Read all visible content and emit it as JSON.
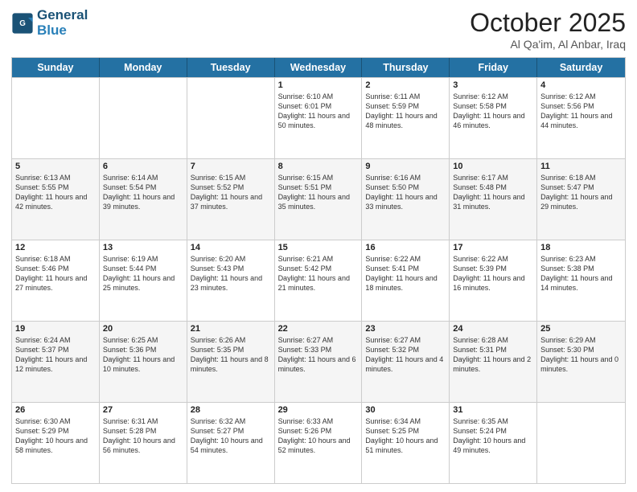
{
  "header": {
    "logo_line1": "General",
    "logo_line2": "Blue",
    "month": "October 2025",
    "location": "Al Qa'im, Al Anbar, Iraq"
  },
  "days_of_week": [
    "Sunday",
    "Monday",
    "Tuesday",
    "Wednesday",
    "Thursday",
    "Friday",
    "Saturday"
  ],
  "weeks": [
    [
      {
        "day": "",
        "sunrise": "",
        "sunset": "",
        "daylight": ""
      },
      {
        "day": "",
        "sunrise": "",
        "sunset": "",
        "daylight": ""
      },
      {
        "day": "",
        "sunrise": "",
        "sunset": "",
        "daylight": ""
      },
      {
        "day": "1",
        "sunrise": "Sunrise: 6:10 AM",
        "sunset": "Sunset: 6:01 PM",
        "daylight": "Daylight: 11 hours and 50 minutes."
      },
      {
        "day": "2",
        "sunrise": "Sunrise: 6:11 AM",
        "sunset": "Sunset: 5:59 PM",
        "daylight": "Daylight: 11 hours and 48 minutes."
      },
      {
        "day": "3",
        "sunrise": "Sunrise: 6:12 AM",
        "sunset": "Sunset: 5:58 PM",
        "daylight": "Daylight: 11 hours and 46 minutes."
      },
      {
        "day": "4",
        "sunrise": "Sunrise: 6:12 AM",
        "sunset": "Sunset: 5:56 PM",
        "daylight": "Daylight: 11 hours and 44 minutes."
      }
    ],
    [
      {
        "day": "5",
        "sunrise": "Sunrise: 6:13 AM",
        "sunset": "Sunset: 5:55 PM",
        "daylight": "Daylight: 11 hours and 42 minutes."
      },
      {
        "day": "6",
        "sunrise": "Sunrise: 6:14 AM",
        "sunset": "Sunset: 5:54 PM",
        "daylight": "Daylight: 11 hours and 39 minutes."
      },
      {
        "day": "7",
        "sunrise": "Sunrise: 6:15 AM",
        "sunset": "Sunset: 5:52 PM",
        "daylight": "Daylight: 11 hours and 37 minutes."
      },
      {
        "day": "8",
        "sunrise": "Sunrise: 6:15 AM",
        "sunset": "Sunset: 5:51 PM",
        "daylight": "Daylight: 11 hours and 35 minutes."
      },
      {
        "day": "9",
        "sunrise": "Sunrise: 6:16 AM",
        "sunset": "Sunset: 5:50 PM",
        "daylight": "Daylight: 11 hours and 33 minutes."
      },
      {
        "day": "10",
        "sunrise": "Sunrise: 6:17 AM",
        "sunset": "Sunset: 5:48 PM",
        "daylight": "Daylight: 11 hours and 31 minutes."
      },
      {
        "day": "11",
        "sunrise": "Sunrise: 6:18 AM",
        "sunset": "Sunset: 5:47 PM",
        "daylight": "Daylight: 11 hours and 29 minutes."
      }
    ],
    [
      {
        "day": "12",
        "sunrise": "Sunrise: 6:18 AM",
        "sunset": "Sunset: 5:46 PM",
        "daylight": "Daylight: 11 hours and 27 minutes."
      },
      {
        "day": "13",
        "sunrise": "Sunrise: 6:19 AM",
        "sunset": "Sunset: 5:44 PM",
        "daylight": "Daylight: 11 hours and 25 minutes."
      },
      {
        "day": "14",
        "sunrise": "Sunrise: 6:20 AM",
        "sunset": "Sunset: 5:43 PM",
        "daylight": "Daylight: 11 hours and 23 minutes."
      },
      {
        "day": "15",
        "sunrise": "Sunrise: 6:21 AM",
        "sunset": "Sunset: 5:42 PM",
        "daylight": "Daylight: 11 hours and 21 minutes."
      },
      {
        "day": "16",
        "sunrise": "Sunrise: 6:22 AM",
        "sunset": "Sunset: 5:41 PM",
        "daylight": "Daylight: 11 hours and 18 minutes."
      },
      {
        "day": "17",
        "sunrise": "Sunrise: 6:22 AM",
        "sunset": "Sunset: 5:39 PM",
        "daylight": "Daylight: 11 hours and 16 minutes."
      },
      {
        "day": "18",
        "sunrise": "Sunrise: 6:23 AM",
        "sunset": "Sunset: 5:38 PM",
        "daylight": "Daylight: 11 hours and 14 minutes."
      }
    ],
    [
      {
        "day": "19",
        "sunrise": "Sunrise: 6:24 AM",
        "sunset": "Sunset: 5:37 PM",
        "daylight": "Daylight: 11 hours and 12 minutes."
      },
      {
        "day": "20",
        "sunrise": "Sunrise: 6:25 AM",
        "sunset": "Sunset: 5:36 PM",
        "daylight": "Daylight: 11 hours and 10 minutes."
      },
      {
        "day": "21",
        "sunrise": "Sunrise: 6:26 AM",
        "sunset": "Sunset: 5:35 PM",
        "daylight": "Daylight: 11 hours and 8 minutes."
      },
      {
        "day": "22",
        "sunrise": "Sunrise: 6:27 AM",
        "sunset": "Sunset: 5:33 PM",
        "daylight": "Daylight: 11 hours and 6 minutes."
      },
      {
        "day": "23",
        "sunrise": "Sunrise: 6:27 AM",
        "sunset": "Sunset: 5:32 PM",
        "daylight": "Daylight: 11 hours and 4 minutes."
      },
      {
        "day": "24",
        "sunrise": "Sunrise: 6:28 AM",
        "sunset": "Sunset: 5:31 PM",
        "daylight": "Daylight: 11 hours and 2 minutes."
      },
      {
        "day": "25",
        "sunrise": "Sunrise: 6:29 AM",
        "sunset": "Sunset: 5:30 PM",
        "daylight": "Daylight: 11 hours and 0 minutes."
      }
    ],
    [
      {
        "day": "26",
        "sunrise": "Sunrise: 6:30 AM",
        "sunset": "Sunset: 5:29 PM",
        "daylight": "Daylight: 10 hours and 58 minutes."
      },
      {
        "day": "27",
        "sunrise": "Sunrise: 6:31 AM",
        "sunset": "Sunset: 5:28 PM",
        "daylight": "Daylight: 10 hours and 56 minutes."
      },
      {
        "day": "28",
        "sunrise": "Sunrise: 6:32 AM",
        "sunset": "Sunset: 5:27 PM",
        "daylight": "Daylight: 10 hours and 54 minutes."
      },
      {
        "day": "29",
        "sunrise": "Sunrise: 6:33 AM",
        "sunset": "Sunset: 5:26 PM",
        "daylight": "Daylight: 10 hours and 52 minutes."
      },
      {
        "day": "30",
        "sunrise": "Sunrise: 6:34 AM",
        "sunset": "Sunset: 5:25 PM",
        "daylight": "Daylight: 10 hours and 51 minutes."
      },
      {
        "day": "31",
        "sunrise": "Sunrise: 6:35 AM",
        "sunset": "Sunset: 5:24 PM",
        "daylight": "Daylight: 10 hours and 49 minutes."
      },
      {
        "day": "",
        "sunrise": "",
        "sunset": "",
        "daylight": ""
      }
    ]
  ]
}
